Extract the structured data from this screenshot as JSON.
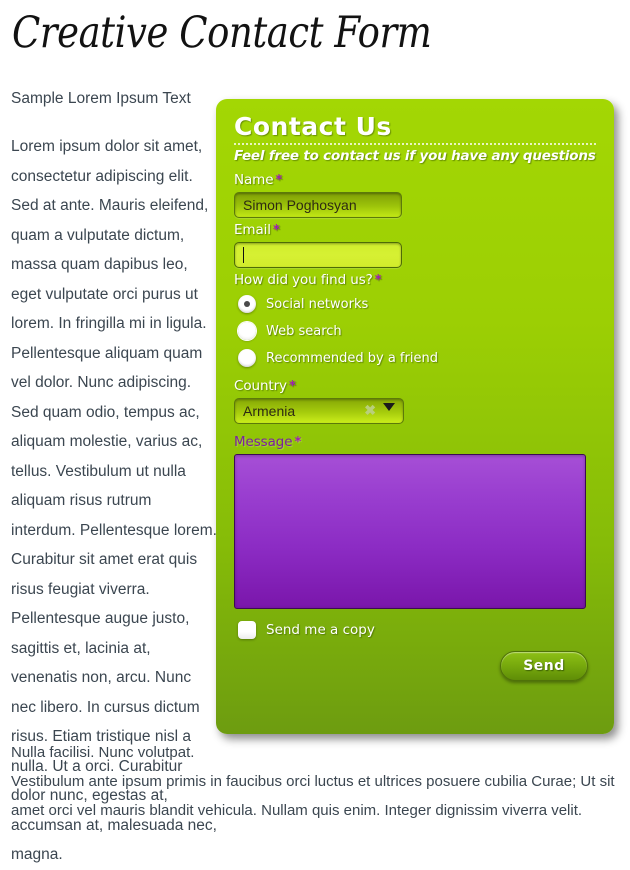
{
  "page": {
    "title": "Creative Contact Form",
    "sample_heading": "Sample Lorem Ipsum Text",
    "body_paragraph": "Lorem ipsum dolor sit amet, consectetur adipiscing elit. Sed at ante. Mauris eleifend, quam a vulputate dictum, massa quam dapibus leo, eget vulputate orci purus ut lorem. In fringilla mi in ligula. Pellentesque aliquam quam vel dolor. Nunc adipiscing. Sed quam odio, tempus ac, aliquam molestie, varius ac, tellus. Vestibulum ut nulla aliquam risus rutrum interdum. Pellentesque lorem. Curabitur sit amet erat quis risus feugiat viverra. Pellentesque augue justo, sagittis et, lacinia at, venenatis non, arcu. Nunc nec libero. In cursus dictum risus. Etiam tristique nisl a nulla. Ut a orci. Curabitur dolor nunc, egestas at, accumsan at, malesuada nec, magna.",
    "footer_line_1": "Nulla facilisi. Nunc volutpat.",
    "footer_line_2": "Vestibulum ante ipsum primis in faucibus orci luctus et ultrices posuere cubilia Curae; Ut sit amet orci vel mauris blandit vehicula. Nullam quis enim. Integer dignissim viverra velit."
  },
  "form": {
    "title": "Contact Us",
    "subtitle": "Feel free to contact us if you have any questions",
    "required_marker": "*",
    "name": {
      "label": "Name",
      "value": "Simon Poghosyan",
      "placeholder": ""
    },
    "email": {
      "label": "Email",
      "value": "",
      "placeholder": "",
      "focused": true
    },
    "find_us": {
      "label": "How did you find us?",
      "options": [
        {
          "label": "Social networks",
          "selected": true
        },
        {
          "label": "Web search",
          "selected": false
        },
        {
          "label": "Recommended by a friend",
          "selected": false
        }
      ]
    },
    "country": {
      "label": "Country",
      "value": "Armenia",
      "clear_icon": "✖",
      "options": [
        "Armenia"
      ]
    },
    "message": {
      "label": "Message",
      "value": "",
      "placeholder": "",
      "state": "error"
    },
    "copy_checkbox": {
      "label": "Send me a copy",
      "checked": false
    },
    "submit_label": "Send"
  },
  "colors": {
    "panel_top": "#a3d704",
    "panel_bottom": "#6d9c10",
    "input_focus": "#d6f033",
    "message_purple": "#8c2cc4",
    "required_star": "#a01fb5",
    "body_text": "#3b4650"
  }
}
